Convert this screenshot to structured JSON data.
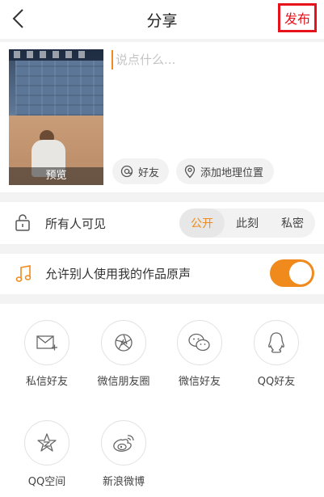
{
  "header": {
    "title": "分享",
    "back_icon": "chevron-left-icon",
    "publish_label": "发布"
  },
  "compose": {
    "caption_placeholder": "说点什么...",
    "preview_label": "预览",
    "mention_label": "好友",
    "location_label": "添加地理位置"
  },
  "privacy": {
    "label": "所有人可见",
    "options": [
      "公开",
      "此刻",
      "私密"
    ],
    "selected": "公开"
  },
  "sound": {
    "label": "允许别人使用我的作品原声",
    "enabled": true
  },
  "share": {
    "items": [
      {
        "label": "私信好友",
        "icon": "mail-plus-icon"
      },
      {
        "label": "微信朋友圈",
        "icon": "aperture-icon"
      },
      {
        "label": "微信好友",
        "icon": "wechat-icon"
      },
      {
        "label": "QQ好友",
        "icon": "qq-icon"
      },
      {
        "label": "QQ空间",
        "icon": "star-icon"
      },
      {
        "label": "新浪微博",
        "icon": "weibo-icon"
      }
    ]
  },
  "colors": {
    "accent": "#f08a1c",
    "highlight_border": "#e6131b"
  }
}
